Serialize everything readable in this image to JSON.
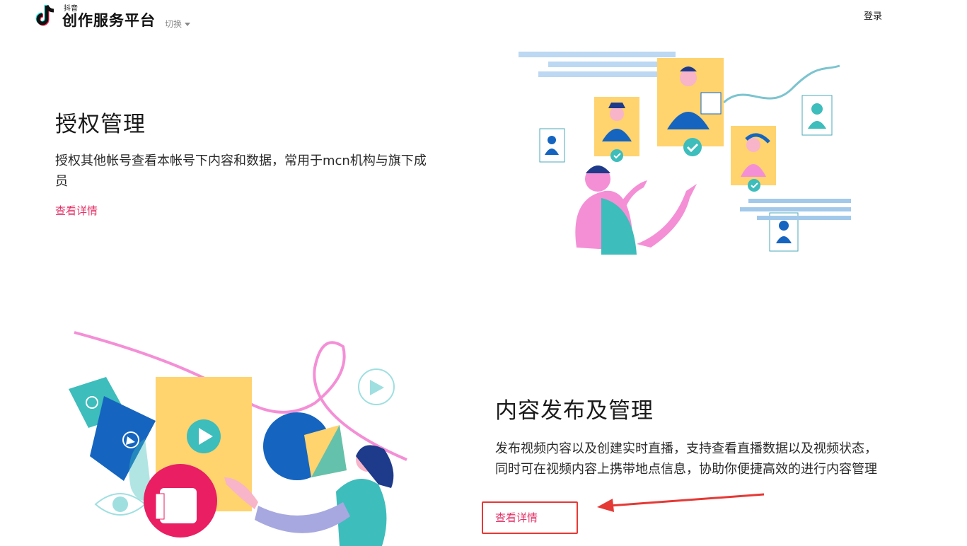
{
  "header": {
    "brand_small": "抖音",
    "brand_title": "创作服务平台",
    "switch_label": "切换",
    "login_label": "登录"
  },
  "sections": [
    {
      "title": "授权管理",
      "description": "授权其他帐号查看本帐号下内容和数据，常用于mcn机构与旗下成员",
      "link_label": "查看详情"
    },
    {
      "title": "内容发布及管理",
      "description": "发布视频内容以及创建实时直播，支持查看直播数据以及视频状态，同时可在视频内容上携带地点信息，协助你便捷高效的进行内容管理",
      "link_label": "查看详情"
    }
  ],
  "colors": {
    "accent_link": "#e2356a",
    "highlight": "#e53935",
    "teal": "#3dbdbb",
    "yellow": "#ffd36e",
    "blue": "#1565c0",
    "pink": "#f48fd6"
  },
  "icons": [
    "douyin-logo-icon",
    "caret-down-icon"
  ]
}
